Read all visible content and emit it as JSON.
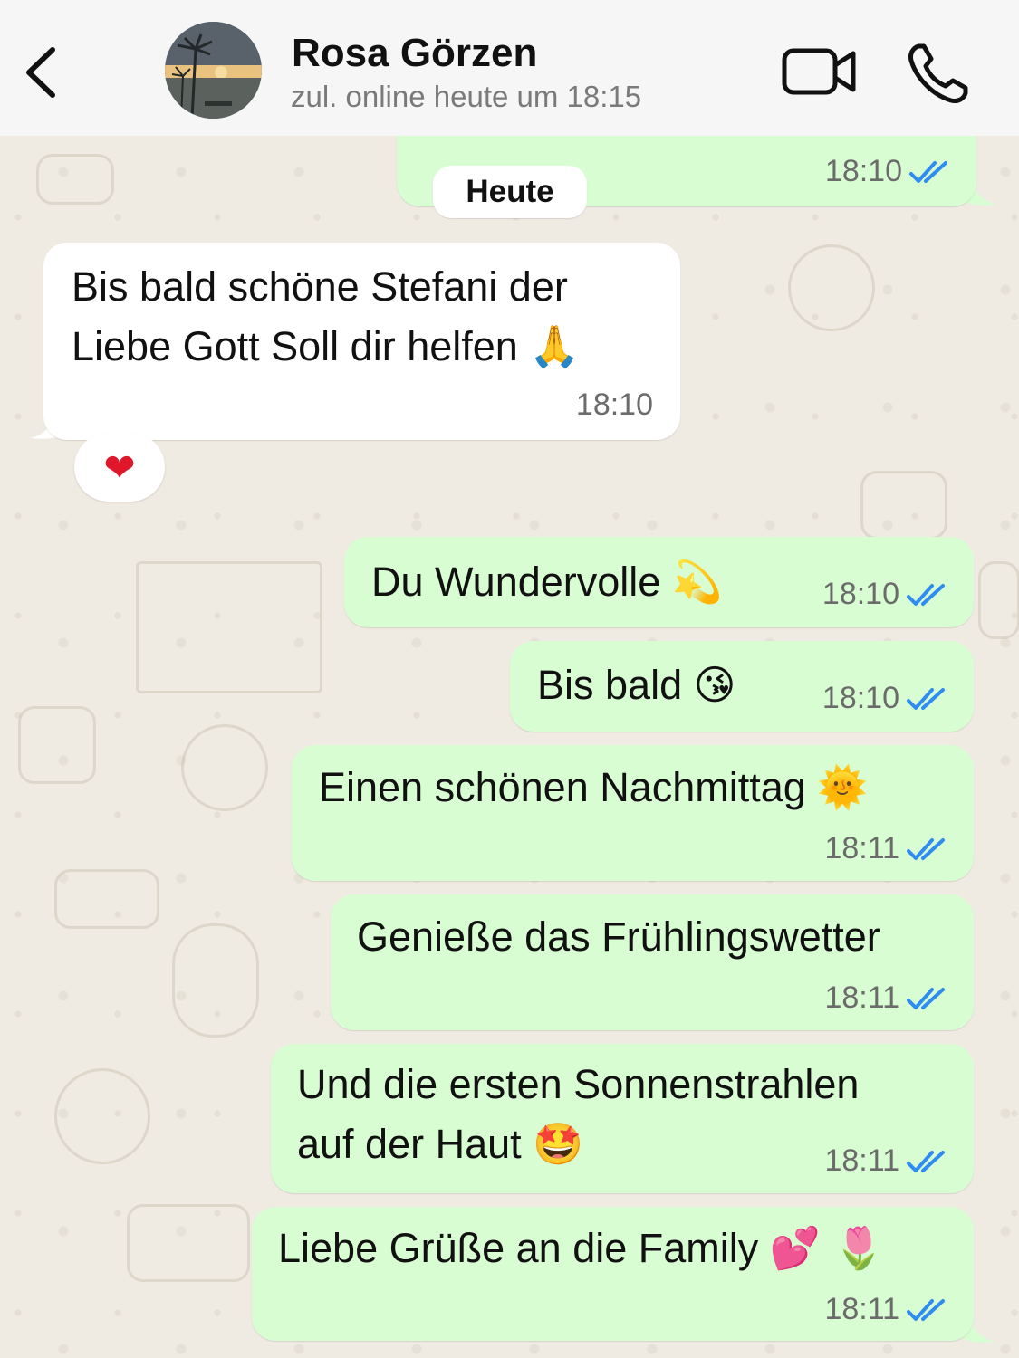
{
  "header": {
    "contact_name": "Rosa Görzen",
    "contact_status": "zul. online heute um 18:15",
    "back_icon": "chevron-left-icon",
    "video_icon": "video-camera-icon",
    "call_icon": "phone-icon"
  },
  "date_separator": "Heute",
  "colors": {
    "outgoing_bubble": "#d9fdd3",
    "incoming_bubble": "#ffffff",
    "read_ticks": "#2f8cf0",
    "background": "#efeae2"
  },
  "messages": [
    {
      "direction": "out",
      "text": "",
      "time": "18:10",
      "status": "read"
    },
    {
      "direction": "in",
      "line1": "Bis bald schöne Stefani der",
      "line2": "Liebe Gott Soll dir helfen",
      "emoji": "🙏",
      "time": "18:10",
      "reaction": "❤"
    },
    {
      "direction": "out",
      "text": "Du Wundervolle",
      "emoji": "💫",
      "time": "18:10",
      "status": "read"
    },
    {
      "direction": "out",
      "text": "Bis bald",
      "emoji": "😘",
      "time": "18:10",
      "status": "read"
    },
    {
      "direction": "out",
      "text": "Einen schönen Nachmittag",
      "emoji": "🌞",
      "time": "18:11",
      "status": "read"
    },
    {
      "direction": "out",
      "text": "Genieße das Frühlingswetter",
      "time": "18:11",
      "status": "read"
    },
    {
      "direction": "out",
      "line1": "Und die ersten Sonnenstrahlen",
      "line2": "auf der Haut",
      "emoji": "🤩",
      "time": "18:11",
      "status": "read"
    },
    {
      "direction": "out",
      "text": "Liebe Grüße an die Family",
      "emoji": "💕 🌷",
      "time": "18:11",
      "status": "read"
    }
  ]
}
